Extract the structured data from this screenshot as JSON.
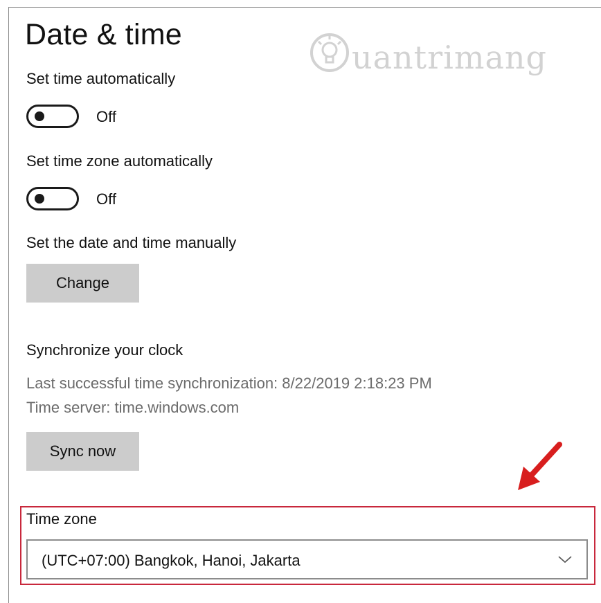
{
  "page": {
    "title": "Date & time"
  },
  "watermark": {
    "text": "uantrimang"
  },
  "set_time_auto": {
    "label": "Set time automatically",
    "state": "Off"
  },
  "set_timezone_auto": {
    "label": "Set time zone automatically",
    "state": "Off"
  },
  "manual": {
    "label": "Set the date and time manually",
    "button_label": "Change"
  },
  "sync": {
    "heading": "Synchronize your clock",
    "last_sync": "Last successful time synchronization: 8/22/2019 2:18:23 PM",
    "server": "Time server: time.windows.com",
    "button_label": "Sync now"
  },
  "timezone": {
    "label": "Time zone",
    "selected": "(UTC+07:00) Bangkok, Hanoi, Jakarta"
  },
  "colors": {
    "highlight_border": "#c8283c",
    "arrow": "#d81e1e",
    "button_bg": "#cccccc"
  },
  "icons": [
    "bulb-logo-icon",
    "chevron-down-icon",
    "red-arrow-icon"
  ]
}
